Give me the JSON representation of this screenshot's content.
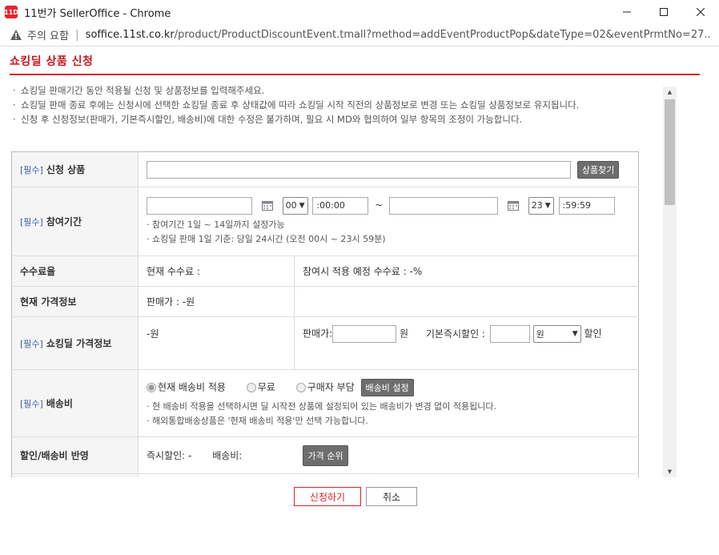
{
  "window": {
    "title": "11번가 SellerOffice - Chrome",
    "app_icon": "11D",
    "controls": [
      "minimize",
      "maximize",
      "close"
    ]
  },
  "address": {
    "security_label": "주의 요함",
    "domain": "soffice.11st.co.kr",
    "path": "/product/ProductDiscountEvent.tmall?method=addEventProductPop&dateType=02&eventPrmtNo=27..."
  },
  "popup": {
    "title": "쇼킹딜 상품 신청"
  },
  "notes": [
    "쇼킹딜 판매기간 동안 적용될 신청 및 상품정보를 입력해주세요.",
    "쇼킹딜 판매 종료 후에는 신청시에 선택한 쇼킹딜 종료 후 상태값에 따라 쇼킹딜 시작 직전의 상품정보로 변경 또는 쇼킹딜 상품정보로 유지됩니다.",
    "신청 후 신청정보(판매가, 기본즉시할인, 배송비)에 대한 수정은 불가하며, 필요 시 MD와 협의하여 일부 항목의 조정이 가능합니다."
  ],
  "form": {
    "required_tag": "[필수]",
    "product": {
      "label": "신청 상품",
      "value": "",
      "button": "상품찾기"
    },
    "period": {
      "label": "참여기간",
      "start_date": "",
      "start_hour": "00",
      "start_time": ":00:00",
      "separator": "~",
      "end_date": "",
      "end_hour": "23",
      "end_time": ":59:59",
      "note1": "참여기간 1일 ~ 14일까지 설정가능",
      "note2": "쇼킹딜 판매 1일 기준: 당일 24시간 (오전 00시 ~ 23시 59분)"
    },
    "commission": {
      "label": "수수료율",
      "current": "현재 수수료 :",
      "planned": "참여시 적용 예정 수수료 : -%"
    },
    "current_price": {
      "label": "현재 가격정보",
      "value": "판매가 : -원"
    },
    "deal_price": {
      "label": "쇼킹딜 가격정보",
      "value": "-원",
      "sale_label": "판매가",
      "sale_unit": "원",
      "discount_label": "기본즉시할인 :",
      "discount_unit_option": "원",
      "discount_suffix": "할인"
    },
    "shipping": {
      "label": "배송비",
      "option1": "현재 배송비 적용",
      "option2": "무료",
      "option3": "구매자 부담",
      "button": "배송비 설정",
      "note1": "현 배송비 적용을 선택하시면 딜 시작전 상품에 설정되어 있는 배송비가 변경 없이 적용됩니다.",
      "note2": "해외통합배송상품은 '현재 배송비 적용'만 선택 가능합니다."
    },
    "reflect": {
      "label": "할인/배송비 반영",
      "discount": "즉시할인: -",
      "shipping": "배송비:",
      "button": "가격 순위"
    }
  },
  "actions": {
    "submit": "신청하기",
    "cancel": "취소"
  }
}
